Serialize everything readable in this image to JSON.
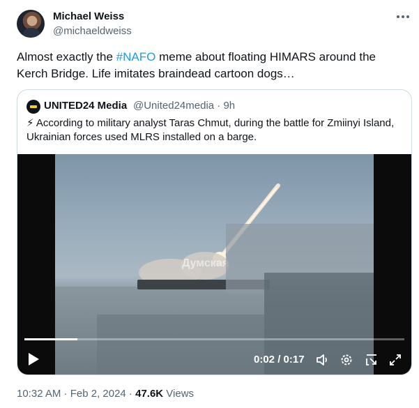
{
  "tweet": {
    "author_name": "Michael Weiss",
    "author_handle": "@michaeldweiss",
    "text_before_hashtag": "Almost exactly the ",
    "hashtag": "#NAFO",
    "text_after_hashtag": " meme about floating HIMARS around the Kerch Bridge. Life imitates braindead cartoon dogs…"
  },
  "quote": {
    "author_name": "UNITED24 Media",
    "author_handle_time": "@United24media · 9h",
    "text": "⚡ According to military analyst Taras Chmut, during the battle for Zmiinyi Island, Ukrainian forces used MLRS installed on a barge."
  },
  "video": {
    "watermark": "Думская",
    "time_display": "0:02 / 0:17",
    "progress": 0.14
  },
  "meta": {
    "timestamp": "10:32 AM · Feb 2, 2024 · ",
    "views_count": "47.6K",
    "views_label": " Views"
  },
  "colors": {
    "accent": "#1d9bf0",
    "secondary_text": "#536471",
    "border": "#cfd9de"
  },
  "icons": [
    "more-icon",
    "play-icon",
    "volume-icon",
    "settings-gear-icon",
    "pip-icon",
    "fullscreen-icon"
  ]
}
